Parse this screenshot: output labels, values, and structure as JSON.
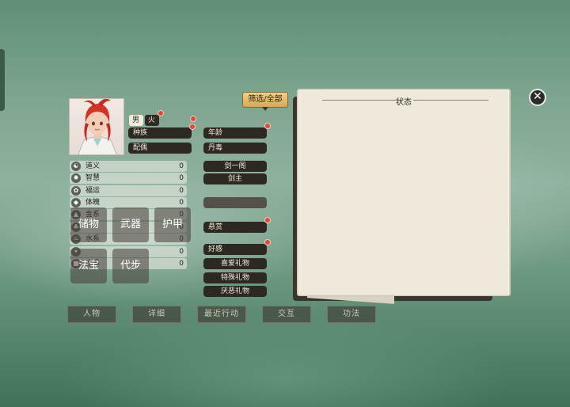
{
  "character": {
    "gender": "男",
    "element": "火",
    "race_label": "种族",
    "spouse_label": "配偶",
    "age_label": "年龄",
    "dan_label": "丹毒",
    "sect": "剑一阁",
    "rank": "剑主",
    "bounty_label": "悬赏",
    "affection_label": "好感",
    "gifts": [
      "喜爱礼物",
      "特殊礼物",
      "厌恶礼物"
    ]
  },
  "stats": [
    {
      "label": "道义",
      "value": "0",
      "icon": "yin-yang-icon"
    },
    {
      "label": "智慧",
      "value": "0",
      "icon": "brain-icon"
    },
    {
      "label": "福运",
      "value": "0",
      "icon": "luck-icon"
    },
    {
      "label": "体魄",
      "value": "0",
      "icon": "body-icon"
    },
    {
      "label": "金系",
      "value": "0",
      "icon": "metal-icon"
    },
    {
      "label": "",
      "value": "0",
      "icon": "wood-icon"
    },
    {
      "label": "水系",
      "value": "0",
      "icon": "water-icon"
    },
    {
      "label": "",
      "value": "0",
      "icon": "fire-icon"
    },
    {
      "label": "土系",
      "value": "0",
      "icon": "earth-icon"
    }
  ],
  "tiles": [
    "储物",
    "武器",
    "护甲",
    "法宝",
    "代步"
  ],
  "filter_label": "筛选/全部",
  "status_panel_title": "状态",
  "close_symbol": "✕",
  "bottom_tabs": [
    "人物",
    "详细",
    "最近行动",
    "交互",
    "功法"
  ]
}
